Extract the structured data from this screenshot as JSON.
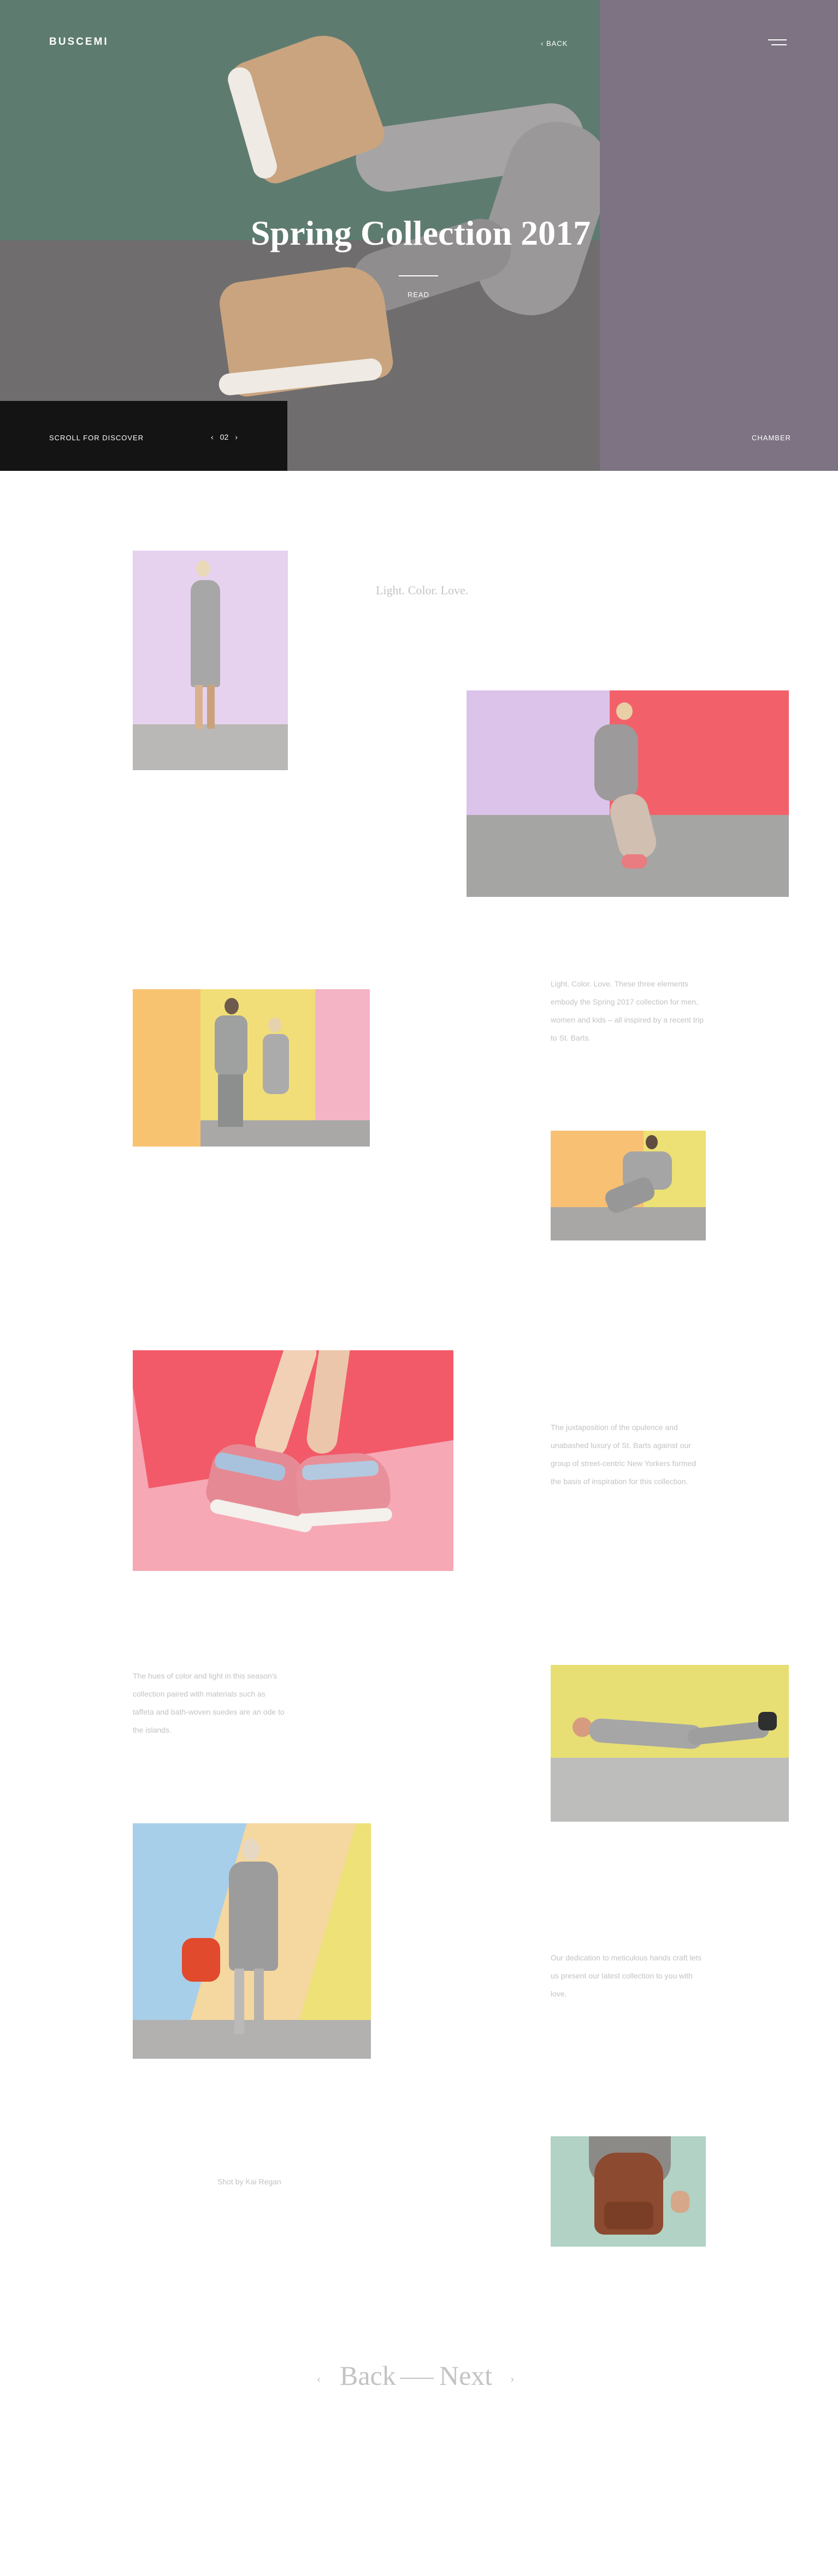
{
  "header": {
    "brand": "BUSCEMI",
    "back_label": "‹ BACK",
    "menu_icon": "hamburger-icon"
  },
  "hero": {
    "title": "Spring Collection 2017",
    "read_label": "READ",
    "scroll_label": "SCROLL FOR DISCOVER",
    "pager": {
      "prev": "‹",
      "current": "02",
      "next": "›"
    },
    "chamber_label": "CHAMBER",
    "colors": {
      "wall": "#5e7b70",
      "floor": "#6f6d6e",
      "side_panel": "#7d7382",
      "scroll_bar": "#141414"
    }
  },
  "gallery": {
    "tagline": "Light. Color. Love.",
    "captions": [
      "Light. Color. Love. These three elements embody the Spring 2017 collection for men, women and kids – all inspired by a recent trip to St. Barts.",
      "The juxtaposition of the opulence and unabashed luxury of St. Barts against our group of street-centric New Yorkers formed the basis of inspiration for this collection.",
      "The hues of color and light in this season's collection paired with materials such as taffeta and bath-woven suedes are an ode to the islands.",
      "Our dedication to meticulous hands craft lets us present our latest collection to you with love.",
      "Shot by Kai Regan"
    ]
  },
  "navigation": {
    "prev_arrow": "‹",
    "back_label": "Back",
    "next_label": "Next",
    "next_arrow": "›"
  }
}
